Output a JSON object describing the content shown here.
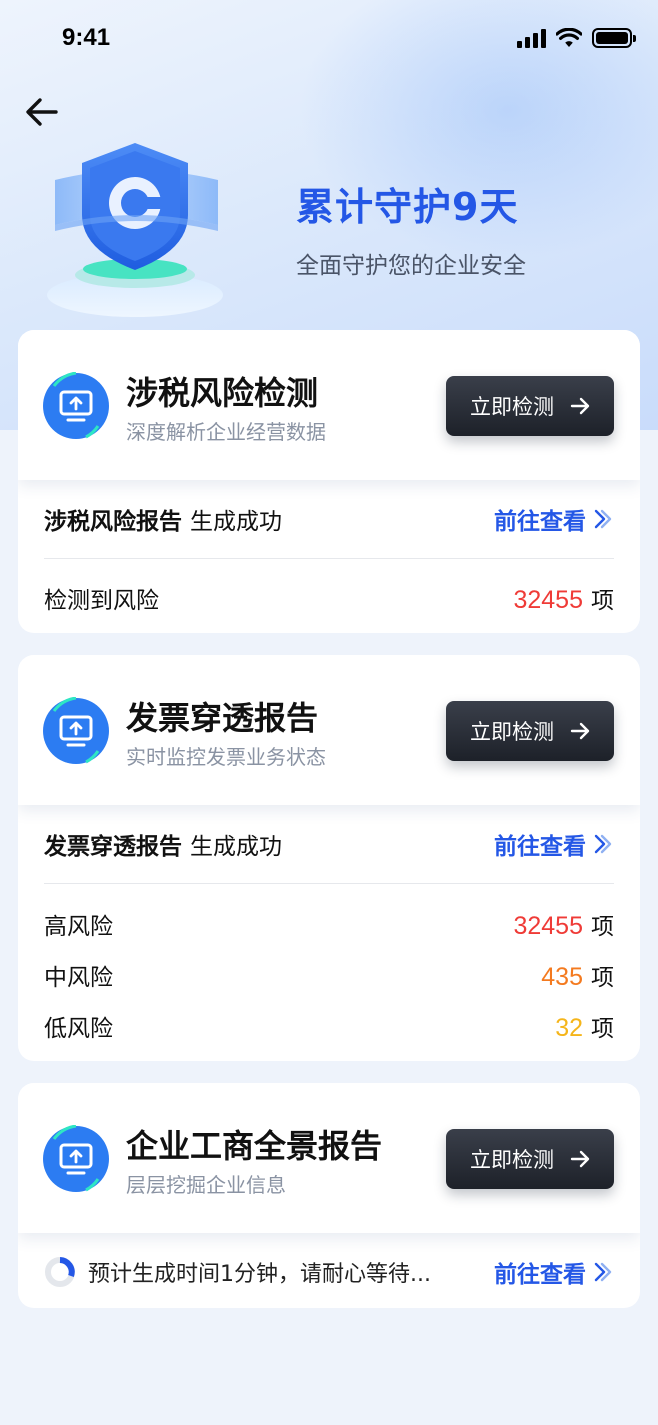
{
  "status_bar": {
    "time": "9:41"
  },
  "hero": {
    "title": "累计守护9天",
    "subtitle": "全面守护您的企业安全"
  },
  "colors": {
    "accent": "#2457e6",
    "risk_high": "#ef3b37",
    "risk_mid": "#f47a1f",
    "risk_low": "#f5b51a",
    "button_dark": "#1d2129"
  },
  "cards": [
    {
      "title": "涉税风险检测",
      "desc": "深度解析企业经营数据",
      "button": "立即检测",
      "icon": "monitor-upload-icon",
      "report_name": "涉税风险报告",
      "report_status": "生成成功",
      "link": "前往查看",
      "risks": [
        {
          "label": "检测到风险",
          "value": "32455",
          "unit": "项",
          "level": "high"
        }
      ]
    },
    {
      "title": "发票穿透报告",
      "desc": "实时监控发票业务状态",
      "button": "立即检测",
      "icon": "monitor-upload-icon",
      "report_name": "发票穿透报告",
      "report_status": "生成成功",
      "link": "前往查看",
      "risks": [
        {
          "label": "高风险",
          "value": "32455",
          "unit": "项",
          "level": "high"
        },
        {
          "label": "中风险",
          "value": "435",
          "unit": "项",
          "level": "mid"
        },
        {
          "label": "低风险",
          "value": "32",
          "unit": "项",
          "level": "low"
        }
      ]
    },
    {
      "title": "企业工商全景报告",
      "desc": "层层挖掘企业信息",
      "button": "立即检测",
      "icon": "monitor-upload-icon",
      "wait_text": "预计生成时间1分钟，请耐心等待...",
      "link": "前往查看"
    }
  ]
}
